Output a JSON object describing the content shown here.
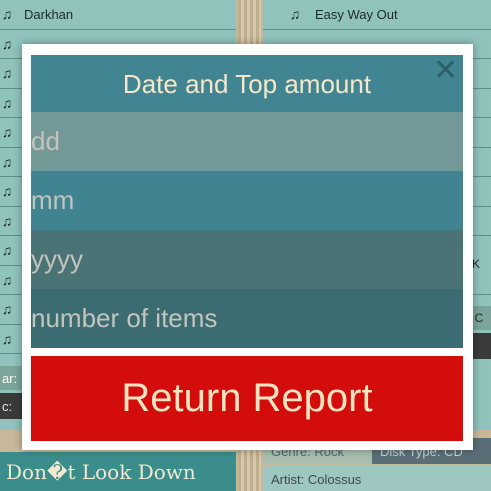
{
  "background": {
    "left_list": {
      "items": [
        "Darkhan",
        "",
        "",
        "",
        "",
        "",
        "",
        "",
        "",
        "",
        "",
        ""
      ],
      "partial_label_1": "ar:",
      "partial_label_2": "c:"
    },
    "right_list": {
      "items": [
        "Easy Way Out",
        "",
        "",
        "",
        "",
        "",
        "",
        "",
        "",
        "",
        "",
        ""
      ],
      "partial_label_1": "o K",
      "partial_label_2": "c: C"
    },
    "bottom_left_title": "Don�t Look Down",
    "bottom_right": {
      "genre": "Genre: Rock",
      "disk_type": "Disk Type: CD",
      "artist": "Artist: Colossus"
    }
  },
  "modal": {
    "title": "Date and Top amount",
    "close_icon": "close-icon",
    "fields": {
      "day_placeholder": "dd",
      "month_placeholder": "mm",
      "year_placeholder": "yyyy",
      "count_placeholder": "number of items"
    },
    "submit_label": "Return Report"
  },
  "colors": {
    "accent": "#418592",
    "submit": "#d30c0c",
    "title_text": "#f6e7c9"
  }
}
